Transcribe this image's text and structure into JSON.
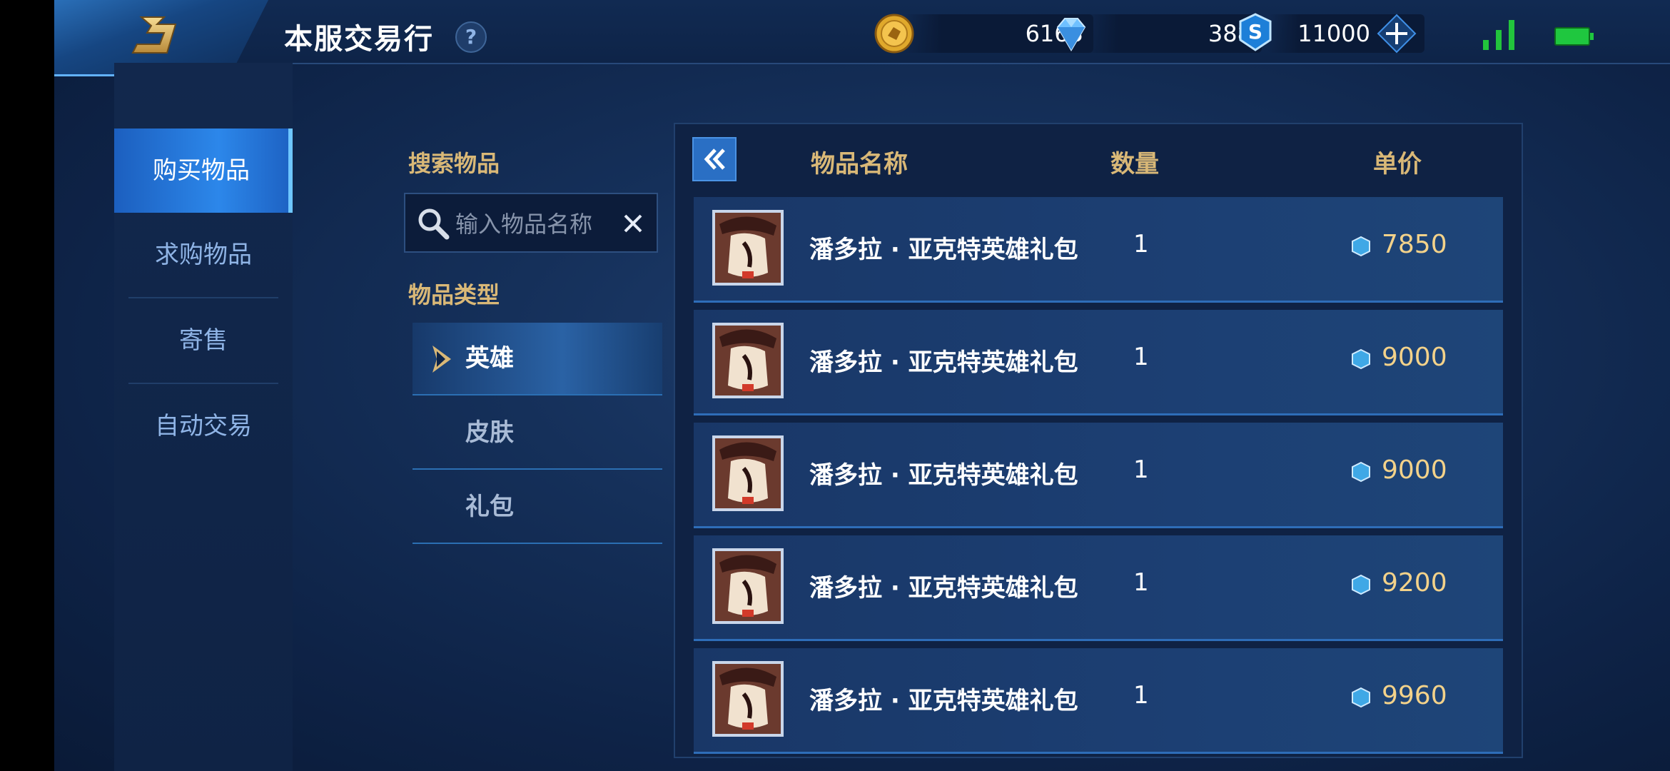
{
  "header": {
    "title": "本服交易行",
    "help_label": "?",
    "icons": [
      "back-icon",
      "help-icon",
      "coin-icon",
      "diamond-icon",
      "voucher-icon",
      "plus-icon",
      "signal-icon",
      "battery-icon"
    ]
  },
  "currencies": {
    "gold": "6163",
    "diamond": "388",
    "voucher": "11000"
  },
  "sidebar": {
    "items": [
      {
        "label": "购买物品",
        "active": true
      },
      {
        "label": "求购物品",
        "active": false
      },
      {
        "label": "寄售",
        "active": false
      },
      {
        "label": "自动交易",
        "active": false
      }
    ]
  },
  "filters": {
    "search_label": "搜索物品",
    "search_placeholder": "输入物品名称",
    "search_value": "",
    "type_label": "物品类型",
    "categories": [
      {
        "label": "英雄",
        "active": true
      },
      {
        "label": "皮肤",
        "active": false
      },
      {
        "label": "礼包",
        "active": false
      }
    ]
  },
  "table": {
    "columns": [
      "物品名称",
      "数量",
      "单价"
    ],
    "rows": [
      {
        "name": "潘多拉 · 亚克特英雄礼包",
        "quantity": "1",
        "price": "7850"
      },
      {
        "name": "潘多拉 · 亚克特英雄礼包",
        "quantity": "1",
        "price": "9000"
      },
      {
        "name": "潘多拉 · 亚克特英雄礼包",
        "quantity": "1",
        "price": "9000"
      },
      {
        "name": "潘多拉 · 亚克特英雄礼包",
        "quantity": "1",
        "price": "9200"
      },
      {
        "name": "潘多拉 · 亚克特英雄礼包",
        "quantity": "1",
        "price": "9960"
      }
    ]
  },
  "colors": {
    "accent_gold": "#d9b877",
    "price_gold": "#f3d28a",
    "active_blue": "#2c87ea",
    "signal_green": "#22c43c",
    "battery_green": "#1fc73f"
  }
}
